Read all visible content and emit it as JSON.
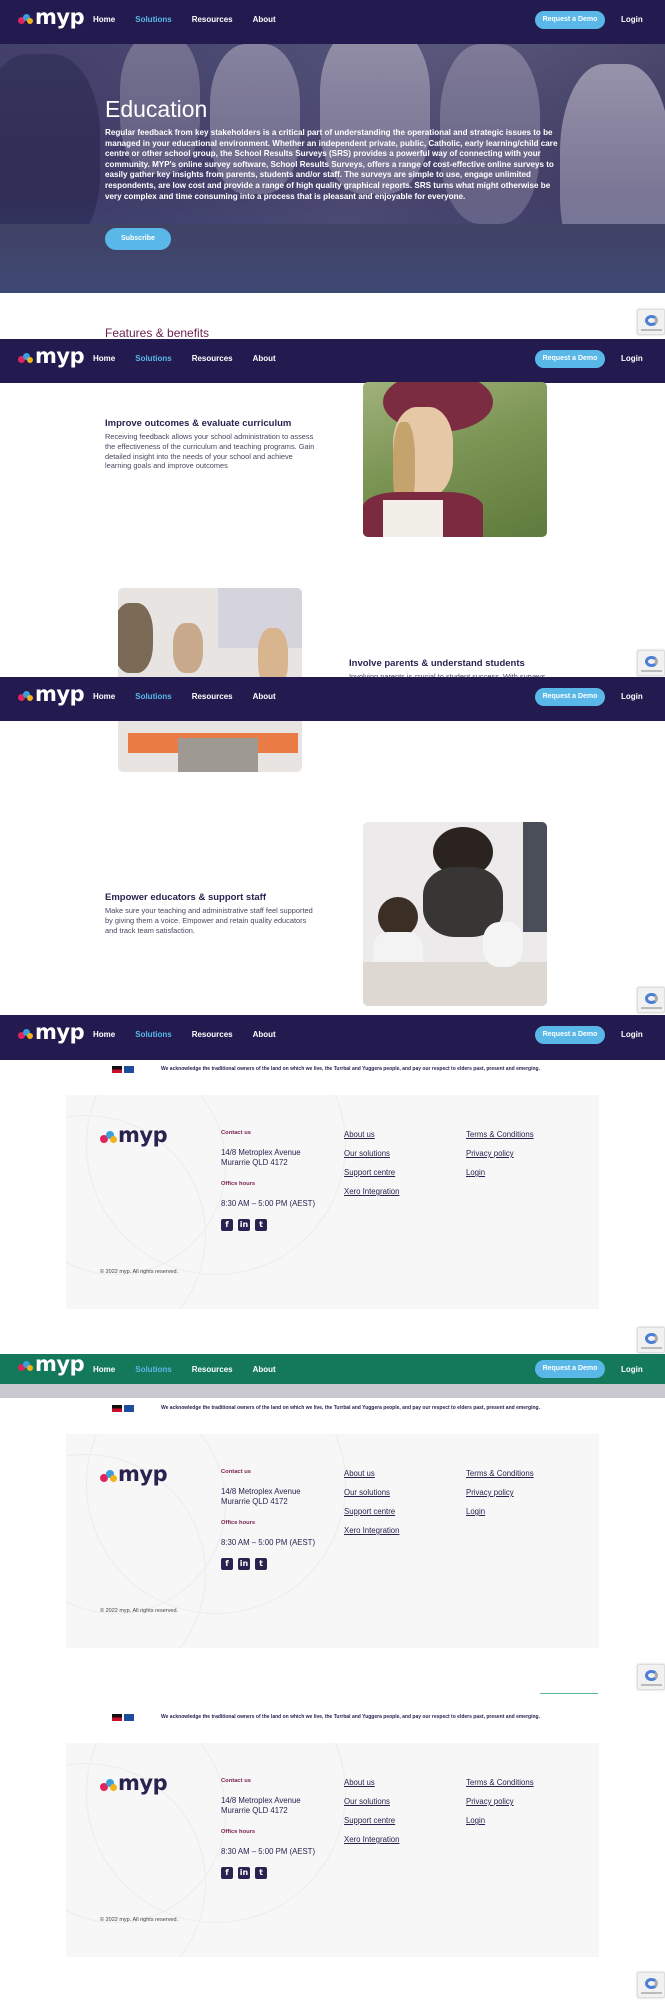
{
  "nav": {
    "logo_text": "myp",
    "links": [
      "Home",
      "Solutions",
      "Resources",
      "About"
    ],
    "active": "Solutions",
    "demo": "Request a Demo",
    "login": "Login"
  },
  "hero": {
    "title": "Education",
    "text": "Regular feedback from key stakeholders is a critical part of understanding the operational and strategic issues to be managed in your educational environment. Whether an independent private, public, Catholic, early learning/child care centre or other school group, the School Results Surveys (SRS) provides a powerful way of connecting with your community. MYP's online survey software, School Results Surveys, offers a range of cost-effective online surveys to easily gather key insights from parents, students and/or staff. The surveys are simple to use, engage unlimited respondents, are low cost and provide a range of high quality graphical reports. SRS turns what might otherwise be very complex and time consuming into a process that is pleasant and enjoyable for everyone.",
    "button": "Subscribe"
  },
  "features": {
    "title": "Features & benefits",
    "items": [
      {
        "title": "Improve outcomes & evaluate curriculum",
        "text": "Receiving feedback allows your school administration to assess the effectiveness of the curriculum and teaching programs. Gain detailed insight into the needs of your school and achieve learning goals and improve outcomes"
      },
      {
        "title": "Involve parents & understand students",
        "text": "Involving parents is crucial to student success. With surveys"
      },
      {
        "title": "Empower educators & support staff",
        "text": "Make sure your teaching and administrative staff feel supported by giving them a voice. Empower and retain quality educators and track team satisfaction."
      }
    ]
  },
  "ack": "We acknowledge the traditional owners of the land on which we live, the Turrbal and Yuggera people, and pay our respect to elders past, present and emerging.",
  "footer": {
    "logo_text": "myp",
    "contact_label": "Contact us",
    "address1": "14/8 Metroplex Avenue",
    "address2": "Murarrie QLD 4172",
    "hours_label": "Office hours",
    "hours": "8:30 AM – 5:00 PM (AEST)",
    "col1": [
      "About us",
      "Our solutions",
      "Support centre",
      "Xero Integration"
    ],
    "col2": [
      "Terms & Conditions",
      "Privacy policy",
      "Login"
    ],
    "social": [
      "facebook-icon",
      "linkedin-icon",
      "twitter-icon"
    ],
    "copyright": "© 2022 myp. All rights reserved."
  },
  "colors": {
    "nav": "#231b4f",
    "nav_green": "#14785a",
    "accent": "#5ab8e8",
    "heading": "#6b1f4f"
  }
}
